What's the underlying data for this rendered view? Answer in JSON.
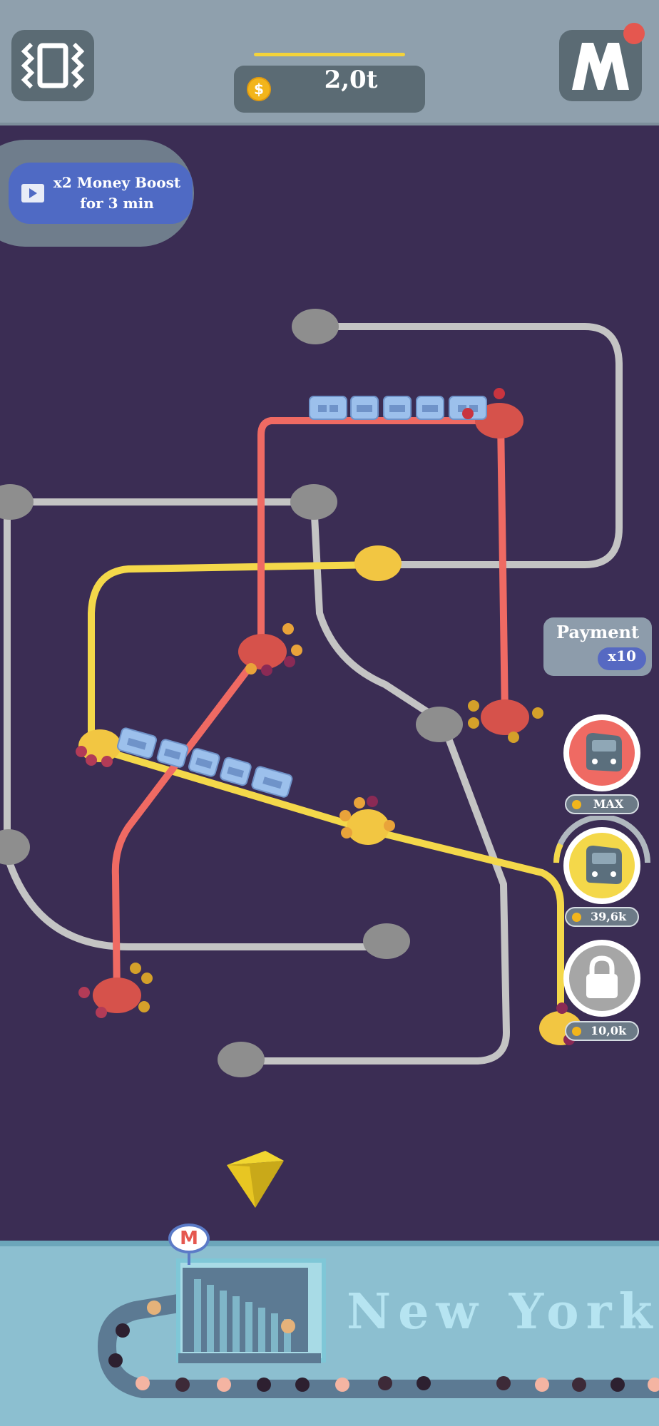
{
  "header": {
    "money_amount": "2,0t",
    "money_currency_icon": "coin-icon",
    "level_progress": 1.0,
    "vibration_icon": "vibration-icon",
    "metro_menu_letter": "M"
  },
  "boost": {
    "line1": "x2 Money Boost",
    "line2": "for 3 min",
    "icon": "video-ad-icon"
  },
  "payment": {
    "label": "Payment",
    "multiplier": "x10"
  },
  "line_buttons": [
    {
      "name": "red-line",
      "color": "#ef6a63",
      "cost": "MAX",
      "icon": "train-icon"
    },
    {
      "name": "yellow-line",
      "color": "#f4d84a",
      "cost": "39,6k",
      "icon": "train-icon"
    },
    {
      "name": "locked-line",
      "color": "#a6a6a6",
      "cost": "10,0k",
      "icon": "lock-icon"
    }
  ],
  "city": {
    "name": "New York",
    "sign_letter": "M"
  },
  "colors": {
    "background": "#3b2d54",
    "red_line": "#ef6a63",
    "yellow_line": "#f4d84a",
    "grey_line": "#b8b8b8",
    "train": "#9cc0ec"
  }
}
